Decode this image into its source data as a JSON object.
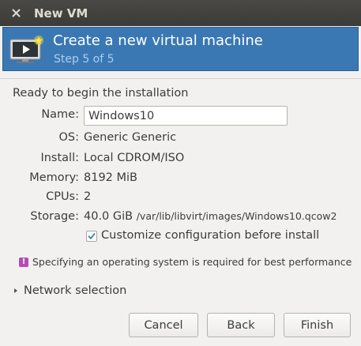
{
  "window": {
    "title": "New VM"
  },
  "header": {
    "title": "Create a new virtual machine",
    "step": "Step 5 of 5",
    "icon": "computer-monitor-star-icon"
  },
  "main": {
    "heading": "Ready to begin the installation",
    "name_label": "Name:",
    "name_value": "Windows10",
    "os_label": "OS:",
    "os_value": "Generic Generic",
    "install_label": "Install:",
    "install_value": "Local CDROM/ISO",
    "memory_label": "Memory:",
    "memory_value": "8192 MiB",
    "cpus_label": "CPUs:",
    "cpus_value": "2",
    "storage_label": "Storage:",
    "storage_size": "40.0 GiB",
    "storage_path": "/var/lib/libvirt/images/Windows10.qcow2",
    "customize_label": "Customize configuration before install",
    "customize_checked": true,
    "warning_text": "Specifying an operating system is required for best performance",
    "network_expander": "Network selection"
  },
  "buttons": {
    "cancel": "Cancel",
    "back": "Back",
    "finish": "Finish"
  },
  "colors": {
    "banner": "#3a78b4",
    "titlebar": "#3c3b37",
    "warning": "#b44cb8",
    "check": "#3a78b4"
  }
}
